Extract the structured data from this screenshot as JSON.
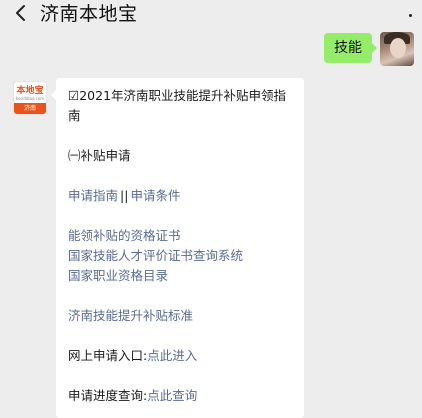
{
  "header": {
    "title": "济南本地宝"
  },
  "outgoing": {
    "text": "技能"
  },
  "account_avatar": {
    "logo_text": "本地宝",
    "logo_sub": "bendibao.com",
    "city_text": "济南"
  },
  "message": {
    "title": "☑2021年济南职业技能提升补贴申领指南",
    "section": "㈠补贴申请",
    "links_row": {
      "first": "申请指南",
      "divider": "||",
      "second": "申请条件"
    },
    "cert_links": [
      "能领补贴的资格证书",
      "国家技能人才评价证书查询系统",
      "国家职业资格目录"
    ],
    "standard_link": "济南技能提升补贴标准",
    "online_apply": {
      "label": "网上申请入口:",
      "link": "点此进入"
    },
    "progress_query": {
      "label": "申请进度查询:",
      "link": "点此查询"
    }
  },
  "colors": {
    "background": "#ededed",
    "outgoing_bubble": "#95ec69",
    "link": "#576b95",
    "logo_orange": "#e8541c"
  },
  "icons": {
    "back": "chevron-left-icon",
    "more": "more-dots-icon"
  }
}
